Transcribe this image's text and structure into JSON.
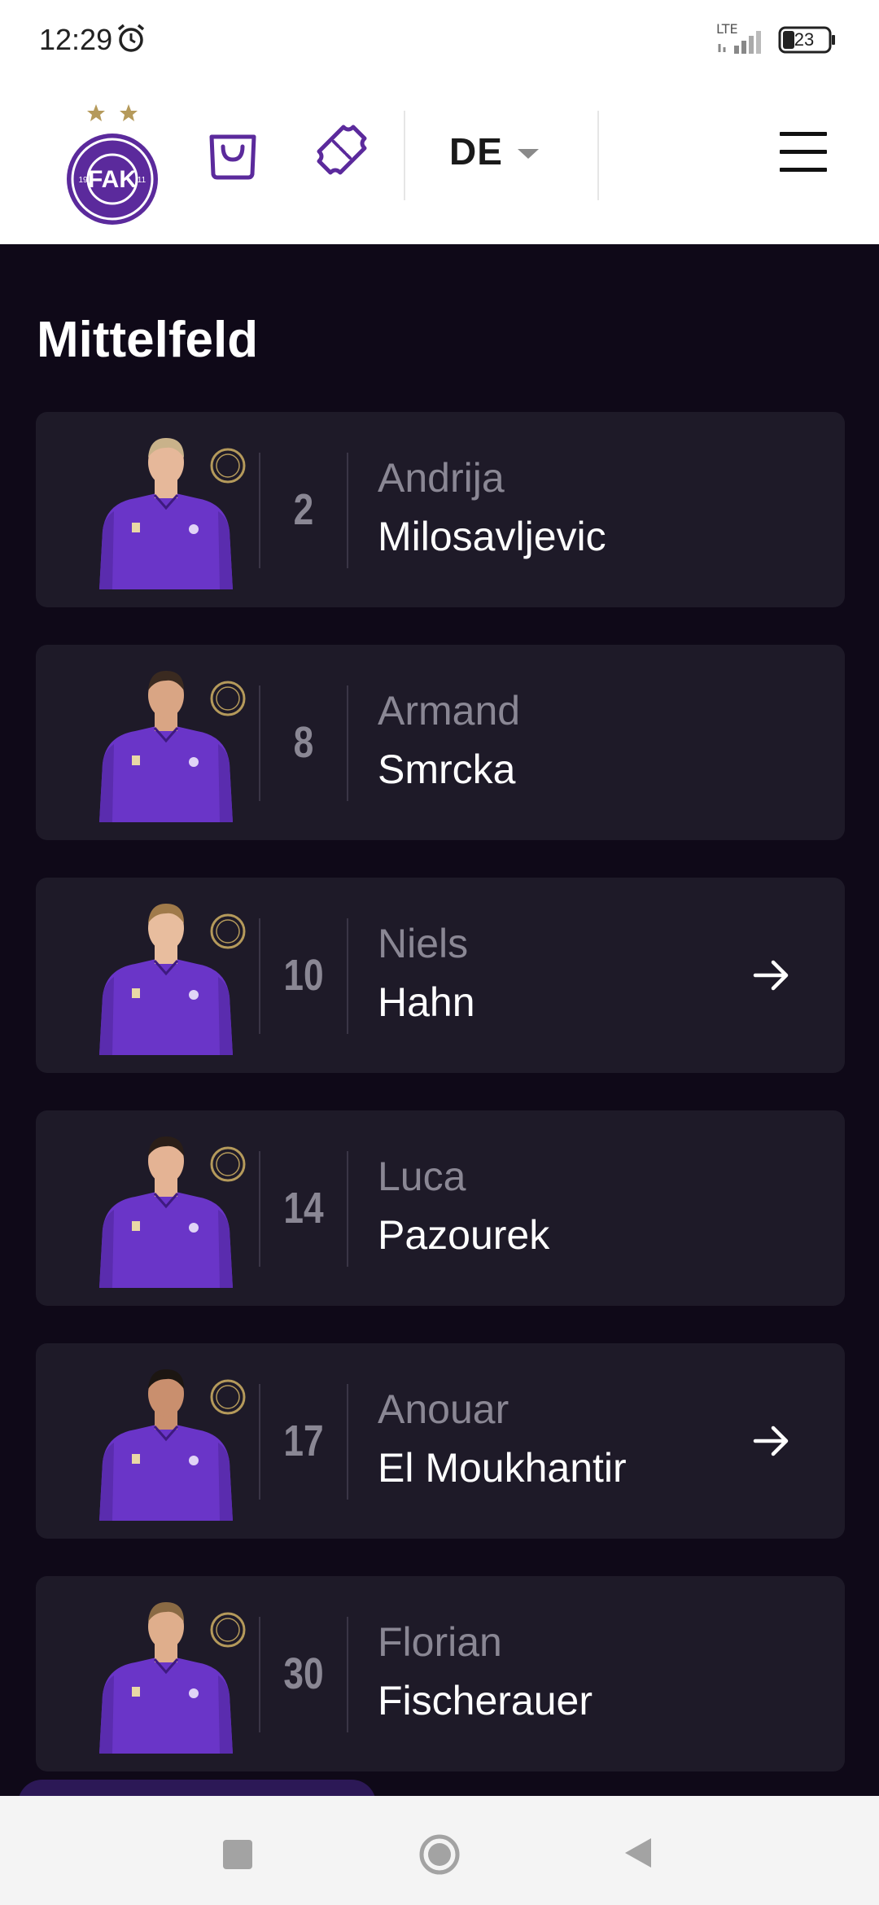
{
  "status_bar": {
    "time": "12:29",
    "network": "LTE",
    "battery": "23"
  },
  "header": {
    "logo_text": "FUSSBALLKLUB AUSTRIA WIEN 1911 FAK",
    "language": "DE"
  },
  "section_title": "Mittelfeld",
  "players": [
    {
      "number": "2",
      "first_name": "Andrija",
      "last_name": "Milosavljevic",
      "has_arrow": false
    },
    {
      "number": "8",
      "first_name": "Armand",
      "last_name": "Smrcka",
      "has_arrow": false
    },
    {
      "number": "10",
      "first_name": "Niels",
      "last_name": "Hahn",
      "has_arrow": true
    },
    {
      "number": "14",
      "first_name": "Luca",
      "last_name": "Pazourek",
      "has_arrow": false
    },
    {
      "number": "17",
      "first_name": "Anouar",
      "last_name": "El Moukhantir",
      "has_arrow": true
    },
    {
      "number": "30",
      "first_name": "Florian",
      "last_name": "Fischerauer",
      "has_arrow": false
    }
  ],
  "colors": {
    "brand_purple": "#5b2a9c",
    "gold": "#b59a5b",
    "background_dark": "#0f0918",
    "card": "#1e1a28"
  },
  "icons": [
    "alarm-icon",
    "signal-icon",
    "battery-icon",
    "shopping-bag-icon",
    "ticket-icon",
    "chevron-down-icon",
    "hamburger-menu-icon",
    "arrow-right-icon"
  ]
}
